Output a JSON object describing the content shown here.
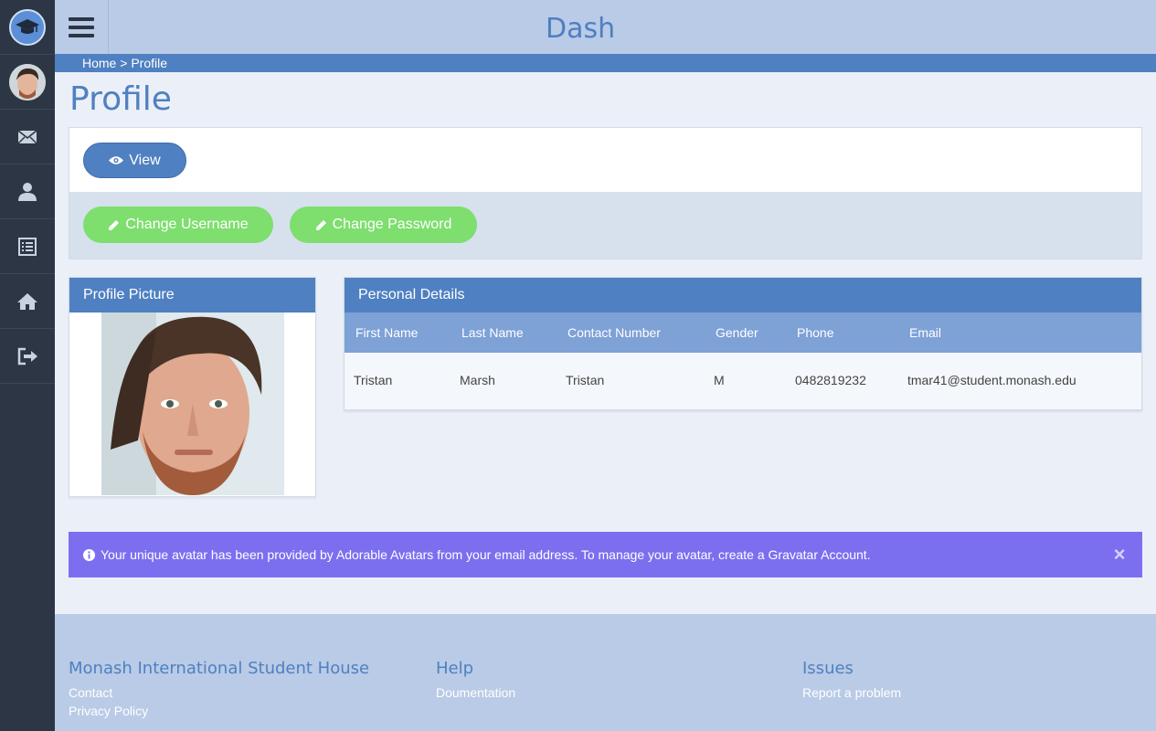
{
  "app": {
    "title": "Dash"
  },
  "breadcrumb": {
    "home": "Home",
    "sep": ">",
    "current": "Profile"
  },
  "page": {
    "title": "Profile"
  },
  "actions": {
    "view_label": "View",
    "change_username_label": "Change Username",
    "change_password_label": "Change Password"
  },
  "profile_picture": {
    "heading": "Profile Picture"
  },
  "personal_details": {
    "heading": "Personal Details",
    "columns": [
      "First Name",
      "Last Name",
      "Contact Number",
      "Gender",
      "Phone",
      "Email"
    ],
    "row": [
      "Tristan",
      "Marsh",
      "Tristan",
      "M",
      "0482819232",
      "tmar41@student.monash.edu"
    ]
  },
  "alert": {
    "message": "Your unique avatar has been provided by Adorable Avatars from your email address. To manage your avatar, create a Gravatar Account.",
    "close": "×"
  },
  "footer": {
    "col1": {
      "title": "Monash International Student House",
      "links": [
        "Contact",
        "Privacy Policy"
      ]
    },
    "col2": {
      "title": "Help",
      "links": [
        "Doumentation"
      ]
    },
    "col3": {
      "title": "Issues",
      "links": [
        "Report a problem"
      ]
    }
  },
  "sidebar": {
    "icons": [
      "graduation-cap-icon",
      "avatar",
      "envelope-icon",
      "user-icon",
      "list-icon",
      "home-icon",
      "sign-out-icon"
    ]
  },
  "colors": {
    "primary": "#4f80c1",
    "sidebar": "#2c3644",
    "success": "#7ede6e",
    "alert": "#7b6ff0",
    "header_bg": "#b9cbe6"
  }
}
